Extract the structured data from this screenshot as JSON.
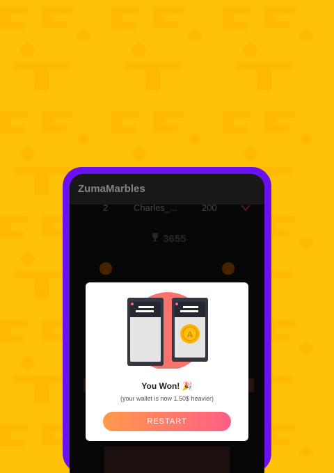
{
  "app": {
    "title": "ZumaMarbles"
  },
  "leaderboard": {
    "rank": "2",
    "name": "Charles_...",
    "score": "200",
    "best_score": "3655"
  },
  "modal": {
    "title": "You Won! 🎉",
    "subtitle": "(your wallet is now 1.50$ heavier)",
    "button_label": "RESTART",
    "coin_letter": "A"
  },
  "colors": {
    "background": "#FFC107",
    "phone_frame": "#6A11F0",
    "button_start": "#FF9A4B",
    "button_end": "#FF5F85"
  }
}
